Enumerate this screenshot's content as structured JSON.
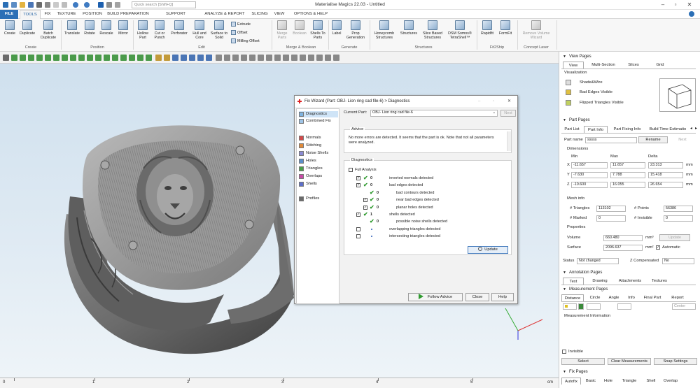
{
  "app": {
    "title": "Materialise Magics 22.03 - Untitled",
    "search_placeholder": "Quick search [Shift+Q]"
  },
  "ribbon_tabs": [
    "FILE",
    "TOOLS",
    "FIX",
    "TEXTURE",
    "POSITION",
    "BUILD PREPARATION",
    "SUPPORT GENERATION",
    "ANALYZE & REPORT",
    "SLICING",
    "VIEW",
    "OPTIONS & HELP"
  ],
  "ribbon": {
    "create": {
      "create": "Create",
      "duplicate": "Duplicate",
      "batch": "Batch Duplicate",
      "group": "Create"
    },
    "position": {
      "translate": "Translate",
      "rotate": "Rotate",
      "rescale": "Rescale",
      "mirror": "Mirror",
      "group": "Position"
    },
    "edit": {
      "hollow": "Hollow Part",
      "cut": "Cut or Punch",
      "perforator": "Perforator",
      "hull": "Hull and Core",
      "surface": "Surface to Solid",
      "extrude": "Extrude",
      "offset": "Offset",
      "milling": "Milling Offset",
      "group": "Edit"
    },
    "merge": {
      "merge": "Merge Parts",
      "boolean": "Boolean",
      "shells": "Shells To Parts",
      "group": "Merge & Boolean"
    },
    "generate": {
      "label": "Label",
      "prop": "Prop Generation",
      "group": "Generate"
    },
    "structures": {
      "honeycomb": "Honeycomb Structures",
      "structures": "Structures",
      "slice": "Slice Based Structures",
      "dsm": "DSM Somos® TetraShell™",
      "group": "Structures"
    },
    "fit2ship": {
      "rapidfit": "Rapidfit",
      "formfit": "FormFit",
      "group": "Fit2Ship"
    },
    "laser": {
      "remove": "Remove Volume Wizard",
      "group": "Concept Laser"
    }
  },
  "dialog": {
    "title": "Fix Wizard (Part: OBJ- Lion ring cad file-6) > Diagnostics",
    "current_part_label": "Current Part:",
    "current_part": "OBJ- Lion ring cad file-6",
    "next": "Next",
    "sidebar": [
      "Diagnostics",
      "Combined Fix",
      "Normals",
      "Stitching",
      "Noise Shells",
      "Holes",
      "Triangles",
      "Overlaps",
      "Shells",
      "Profiles"
    ],
    "advice_title": "Advice",
    "advice_text": "No more errors are detected. It seems that the part is ok. Note that not all parameters were analyzed.",
    "diagnostics_title": "Diagnostics",
    "full_analysis": "Full Analysis",
    "items": [
      {
        "label": "inverted normals detected",
        "count": "0",
        "check": true,
        "tick": true,
        "indent": 0
      },
      {
        "label": "bad edges detected",
        "count": "0",
        "check": true,
        "tick": true,
        "indent": 0
      },
      {
        "label": "bad contours detected",
        "count": "0",
        "check": false,
        "tick": true,
        "indent": 1
      },
      {
        "label": "near bad edges detected",
        "count": "0",
        "check": true,
        "tick": true,
        "indent": 1
      },
      {
        "label": "planar holes detected",
        "count": "0",
        "check": true,
        "tick": true,
        "indent": 1
      },
      {
        "label": "shells detected",
        "count": "1",
        "check": true,
        "tick": true,
        "indent": 0
      },
      {
        "label": "possible noise shells detected",
        "count": "0",
        "check": false,
        "tick": true,
        "indent": 1
      },
      {
        "label": "overlapping triangles detected",
        "count": "",
        "check": false,
        "tick": false,
        "indent": 0
      },
      {
        "label": "intersecting triangles detected",
        "count": "",
        "check": false,
        "tick": false,
        "indent": 0
      }
    ],
    "update": "Update",
    "follow_advice": "Follow Advice",
    "close": "Close",
    "help": "Help"
  },
  "right_panel": {
    "view_pages": "View Pages",
    "view_tabs": [
      "View",
      "Multi-Section",
      "Slices",
      "Grid"
    ],
    "visualization": "Visualization",
    "vis_items": [
      "Shade&Wire",
      "Bad Edges Visible",
      "Flipped Triangles Visible"
    ],
    "part_pages": "Part Pages",
    "part_tabs": [
      "Part List",
      "Part Info",
      "Part Fixing Info",
      "Build Time Estimatio"
    ],
    "part_name_label": "Part name",
    "part_name": "sssss",
    "rename": "Rename",
    "next": "Next",
    "dimensions": "Dimensions",
    "dim_headers": [
      "Min",
      "Max",
      "Delta"
    ],
    "dims": [
      {
        "axis": "X",
        "min": "-11.657",
        "max": "11.657",
        "delta": "23.313",
        "unit": "mm"
      },
      {
        "axis": "Y",
        "min": "-7.630",
        "max": "7.788",
        "delta": "15.418",
        "unit": "mm"
      },
      {
        "axis": "Z",
        "min": "-10.600",
        "max": "16.055",
        "delta": "26.654",
        "unit": "mm"
      }
    ],
    "mesh_info": "Mesh info",
    "triangles_label": "# Triangles",
    "triangles": "113102",
    "points_label": "# Points",
    "points": "56386",
    "marked_label": "# Marked",
    "marked": "0",
    "invisible_label": "# Invisible",
    "invisible": "0",
    "properties": "Properties",
    "volume_label": "Volume",
    "volume": "660.480",
    "volume_unit": "mm³",
    "update": "Update",
    "surface_label": "Surface",
    "surface": "2096.637",
    "surface_unit": "mm²",
    "automatic": "Automatic",
    "status_label": "Status",
    "status": "Not changed",
    "zcomp_label": "Z Compensated",
    "zcomp": "No",
    "annotation_pages": "Annotation Pages",
    "annotation_tabs": [
      "Text",
      "Drawing",
      "Attachments",
      "Textures"
    ],
    "measurement_pages": "Measurement Pages",
    "measure_tabs": [
      "Distance",
      "Circle",
      "Angle",
      "Info",
      "Final Part",
      "Report"
    ],
    "center": "Center",
    "measurement_info": "Measurement Information",
    "invisible_chk": "Invisible",
    "select": "Select",
    "clear": "Clear Measurements",
    "snap": "Snap Settings",
    "fix_pages": "Fix Pages",
    "fix_tabs": [
      "Autofix",
      "Basic",
      "Hole",
      "Triangle",
      "Shell",
      "Overlap"
    ]
  },
  "ruler": [
    "0",
    "1",
    "2",
    "3",
    "4",
    "5",
    "cm"
  ]
}
